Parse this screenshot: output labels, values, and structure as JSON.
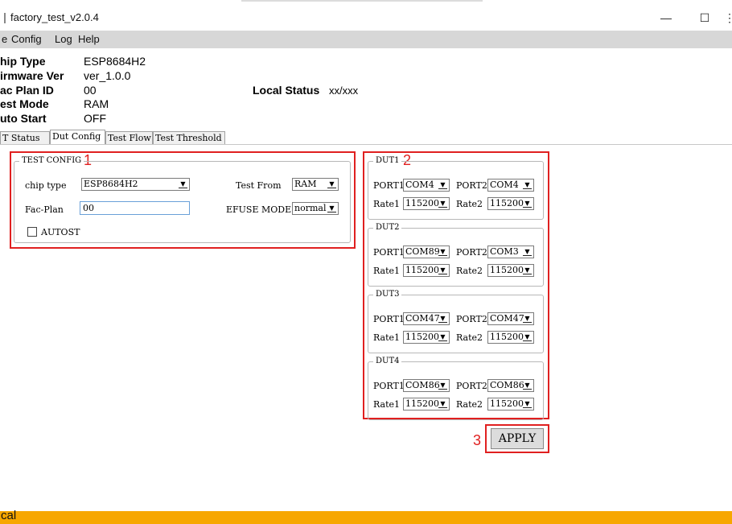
{
  "window": {
    "title": "factory_test_v2.0.4",
    "minimize": "—",
    "maximize": "☐",
    "close": "⋮"
  },
  "menu": {
    "file": "e",
    "config": "Config",
    "log": "Log",
    "help": "Help"
  },
  "info": {
    "chip_type_label": "hip Type",
    "chip_type_value": "ESP8684H2",
    "firmware_label": "irmware Ver",
    "firmware_value": "ver_1.0.0",
    "fac_plan_label": "ac Plan ID",
    "fac_plan_value": "00",
    "test_mode_label": "est Mode",
    "test_mode_value": "RAM",
    "auto_start_label": "uto Start",
    "auto_start_value": "OFF",
    "local_status_label": "Local Status",
    "local_status_value": "xx/xxx"
  },
  "tabs": [
    "T Status",
    "Dut Config",
    "Test Flow",
    "Test Threshold"
  ],
  "test_config": {
    "legend": "TEST CONFIG",
    "chip_type_label": "chip type",
    "chip_type_value": "ESP8684H2",
    "fac_plan_label": "Fac-Plan",
    "fac_plan_value": "00",
    "autost_label": "AUTOST",
    "test_from_label": "Test From",
    "test_from_value": "RAM",
    "efuse_label": "EFUSE MODE",
    "efuse_value": "normal"
  },
  "port_labels": {
    "port1": "PORT1",
    "port2": "PORT2",
    "rate1": "Rate1",
    "rate2": "Rate2"
  },
  "duts": [
    {
      "name": "DUT1",
      "port1": "COM4",
      "port2": "COM4",
      "rate1": "115200",
      "rate2": "115200"
    },
    {
      "name": "DUT2",
      "port1": "COM89",
      "port2": "COM3",
      "rate1": "115200",
      "rate2": "115200"
    },
    {
      "name": "DUT3",
      "port1": "COM47",
      "port2": "COM47",
      "rate1": "115200",
      "rate2": "115200"
    },
    {
      "name": "DUT4",
      "port1": "COM86",
      "port2": "COM86",
      "rate1": "115200",
      "rate2": "115200"
    }
  ],
  "annotations": {
    "n1": "1",
    "n2": "2",
    "n3": "3"
  },
  "apply_label": "APPLY",
  "status_bar": "cal",
  "colors": {
    "annotation_red": "#e02020",
    "status_bar": "#f7a700",
    "menubar": "#d7d7d7"
  }
}
